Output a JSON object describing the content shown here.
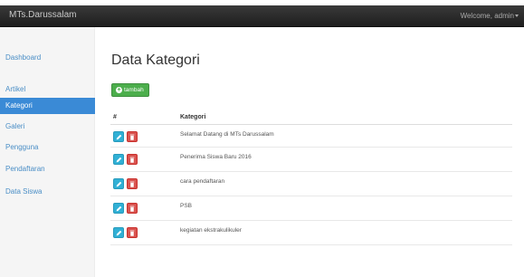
{
  "navbar": {
    "brand": "MTs.Darussalam",
    "welcome": "Welcome, admin"
  },
  "sidebar": {
    "items": [
      {
        "label": "Dashboard",
        "active": false
      },
      {
        "label": "Artikel",
        "active": false
      },
      {
        "label": "Kategori",
        "active": true
      },
      {
        "label": "Galeri",
        "active": false
      },
      {
        "label": "Pengguna",
        "active": false
      },
      {
        "label": "Pendaftaran",
        "active": false
      },
      {
        "label": "Data Siswa",
        "active": false
      }
    ]
  },
  "main": {
    "title": "Data Kategori",
    "add_button_label": "tambah",
    "table": {
      "headers": [
        "#",
        "Kategori"
      ],
      "rows": [
        {
          "kategori": "Selamat Datang di MTs Darussalam"
        },
        {
          "kategori": "Penerima Siswa Baru 2016"
        },
        {
          "kategori": "cara pendaftaran"
        },
        {
          "kategori": "PSB"
        },
        {
          "kategori": "kegiatan ekstrakulikuler"
        }
      ]
    }
  },
  "icons": {
    "edit": "pencil-icon",
    "delete": "trash-icon",
    "add": "plus-circle-icon"
  },
  "colors": {
    "navbar": "#222222",
    "active_sidebar": "#3a8ad6",
    "link": "#4a8ec6",
    "add_button": "#4cae4c",
    "edit_button": "#31b0d5",
    "delete_button": "#d9534f"
  }
}
